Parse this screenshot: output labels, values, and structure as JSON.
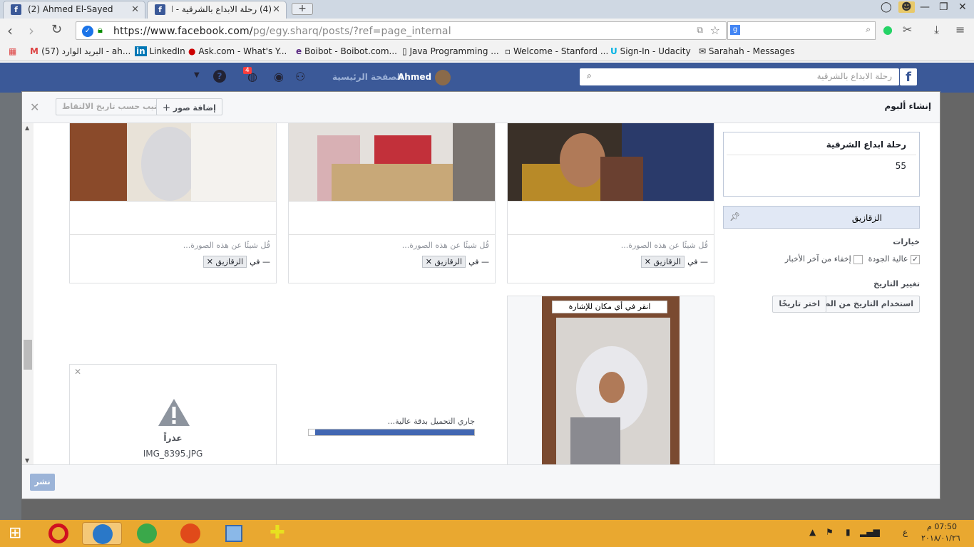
{
  "browser": {
    "tabs": [
      {
        "label": "(2) Ahmed El-Sayed",
        "icon": "facebook-icon"
      },
      {
        "label": "(4) رحلة الابداع بالشرقية - الم",
        "icon": "facebook-icon"
      }
    ],
    "url_host": "https://www.facebook.com/",
    "url_path": "pg/egy.sharq/posts/?ref=page_internal",
    "bookmarks": [
      "البريد الوارد (57) - ah...",
      "LinkedIn",
      "Ask.com - What's Y...",
      "Boibot - Boibot.com...",
      "Java Programming ...",
      "Welcome - Stanford ...",
      "Sign-In - Udacity",
      "Sarahah - Messages"
    ]
  },
  "facebook": {
    "search_placeholder": "رحلة الابداع بالشرقية",
    "home_label": "الصفحة الرئيسية",
    "user_name": "Ahmed",
    "notif_count": "4"
  },
  "modal": {
    "title": "إنشاء ألبوم",
    "add_photos": "إضافة صور",
    "sort_by_date": "ترتيب حسب تاريخ الالتقاط",
    "publish": "نشر",
    "photo_caption_placeholder": "قُل شيئًا عن هذه الصورة...",
    "location_prefix": "— في",
    "location_tag": "الزقازيق",
    "tag_prompt": "انقر في أي مكان للإشارة",
    "error_title": "عذراً",
    "error_filename": "IMG_8395.JPG",
    "uploading_text": "جاري التحميل بدقة عالية...",
    "upload_progress": 0.96,
    "album_title": "رحلة ابداع الشرقية",
    "album_description": "55",
    "album_location": "الزقازيق",
    "options_heading": "خيارات",
    "high_quality": "عالية الجودة",
    "hide_from_feed": "إخفاء من آخر الأخبار",
    "change_date_heading": "تغيير التاريخ",
    "use_photo_date": "استخدام التاريخ من الصور",
    "pick_date": "اختر تاريخًا"
  },
  "taskbar": {
    "time": "07:50 م",
    "date": "٢٠١٨/٠١/٢٦",
    "lang": "ع"
  }
}
